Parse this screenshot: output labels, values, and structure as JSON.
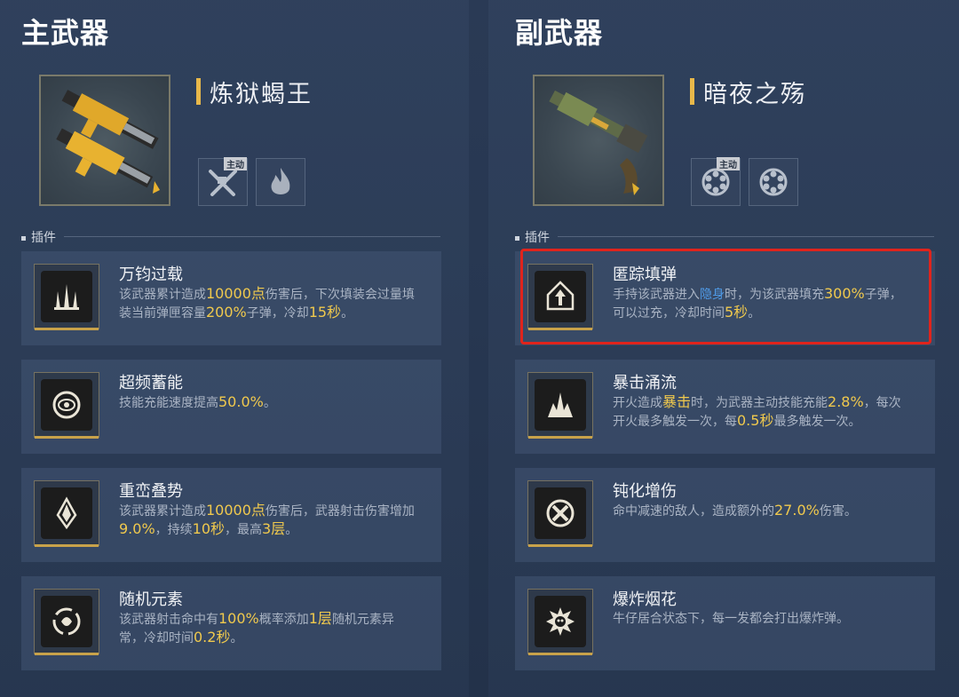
{
  "primary": {
    "title": "主武器",
    "weapon_name": "炼狱蝎王",
    "skills": [
      {
        "icon": "crossed-guns-icon",
        "tag": "主动"
      },
      {
        "icon": "flame-icon",
        "tag": ""
      }
    ],
    "section_label": "插件",
    "mods": [
      {
        "title": "万钧过载",
        "icon": "triple-flame-icon",
        "desc": [
          [
            "该武器累计造成",
            ""
          ],
          [
            "10000点",
            "hl"
          ],
          [
            "伤害后，下次填装会过量填装当前弹匣容量",
            ""
          ],
          [
            "200%",
            "hl"
          ],
          [
            "子弹，冷却",
            ""
          ],
          [
            "15秒",
            "hl"
          ],
          [
            "。",
            ""
          ]
        ]
      },
      {
        "title": "超频蓄能",
        "icon": "vortex-eye-icon",
        "desc": [
          [
            "技能充能速度提高",
            ""
          ],
          [
            "50.0%",
            "hl"
          ],
          [
            "。",
            ""
          ]
        ]
      },
      {
        "title": "重峦叠势",
        "icon": "crystal-peak-icon",
        "desc": [
          [
            "该武器累计造成",
            ""
          ],
          [
            "10000点",
            "hl"
          ],
          [
            "伤害后，武器射击伤害增加",
            ""
          ],
          [
            "9.0%",
            "hl"
          ],
          [
            "，持续",
            ""
          ],
          [
            "10秒",
            "hl"
          ],
          [
            "，最高",
            ""
          ],
          [
            "3层",
            "hl"
          ],
          [
            "。",
            ""
          ]
        ]
      },
      {
        "title": "随机元素",
        "icon": "element-swirl-icon",
        "desc": [
          [
            "该武器射击命中有",
            ""
          ],
          [
            "100%",
            "hl"
          ],
          [
            "概率添加",
            ""
          ],
          [
            "1层",
            "hl"
          ],
          [
            "随机元素异常，冷却时间",
            ""
          ],
          [
            "0.2秒",
            "hl"
          ],
          [
            "。",
            ""
          ]
        ]
      }
    ]
  },
  "secondary": {
    "title": "副武器",
    "weapon_name": "暗夜之殇",
    "skills": [
      {
        "icon": "revolver-cylinder-icon",
        "tag": "主动"
      },
      {
        "icon": "revolver-cylinder-icon",
        "tag": ""
      }
    ],
    "section_label": "插件",
    "mods": [
      {
        "title": "匿踪填弹",
        "icon": "hooded-arrow-icon",
        "highlighted": true,
        "desc": [
          [
            "手持该武器进入",
            ""
          ],
          [
            "隐身",
            "hl-blue"
          ],
          [
            "时，为该武器填充",
            ""
          ],
          [
            "300%",
            "hl"
          ],
          [
            "子弹，可以过充，冷却时间",
            ""
          ],
          [
            "5秒",
            "hl"
          ],
          [
            "。",
            ""
          ]
        ]
      },
      {
        "title": "暴击涌流",
        "icon": "burst-spikes-icon",
        "desc": [
          [
            "开火造成",
            ""
          ],
          [
            "暴击",
            "hl"
          ],
          [
            "时，为武器主动技能充能",
            ""
          ],
          [
            "2.8%",
            "hl"
          ],
          [
            "，每次开火最多触发一次，每",
            ""
          ],
          [
            "0.5秒",
            "hl"
          ],
          [
            "最多触发一次。",
            ""
          ]
        ]
      },
      {
        "title": "钝化增伤",
        "icon": "crossed-circle-icon",
        "desc": [
          [
            "命中减速的敌人，造成额外的",
            ""
          ],
          [
            "27.0%",
            "hl"
          ],
          [
            "伤害。",
            ""
          ]
        ]
      },
      {
        "title": "爆炸烟花",
        "icon": "explosion-skull-icon",
        "desc": [
          [
            "牛仔居合状态下，每一发都会打出爆炸弹。",
            ""
          ]
        ]
      }
    ]
  }
}
